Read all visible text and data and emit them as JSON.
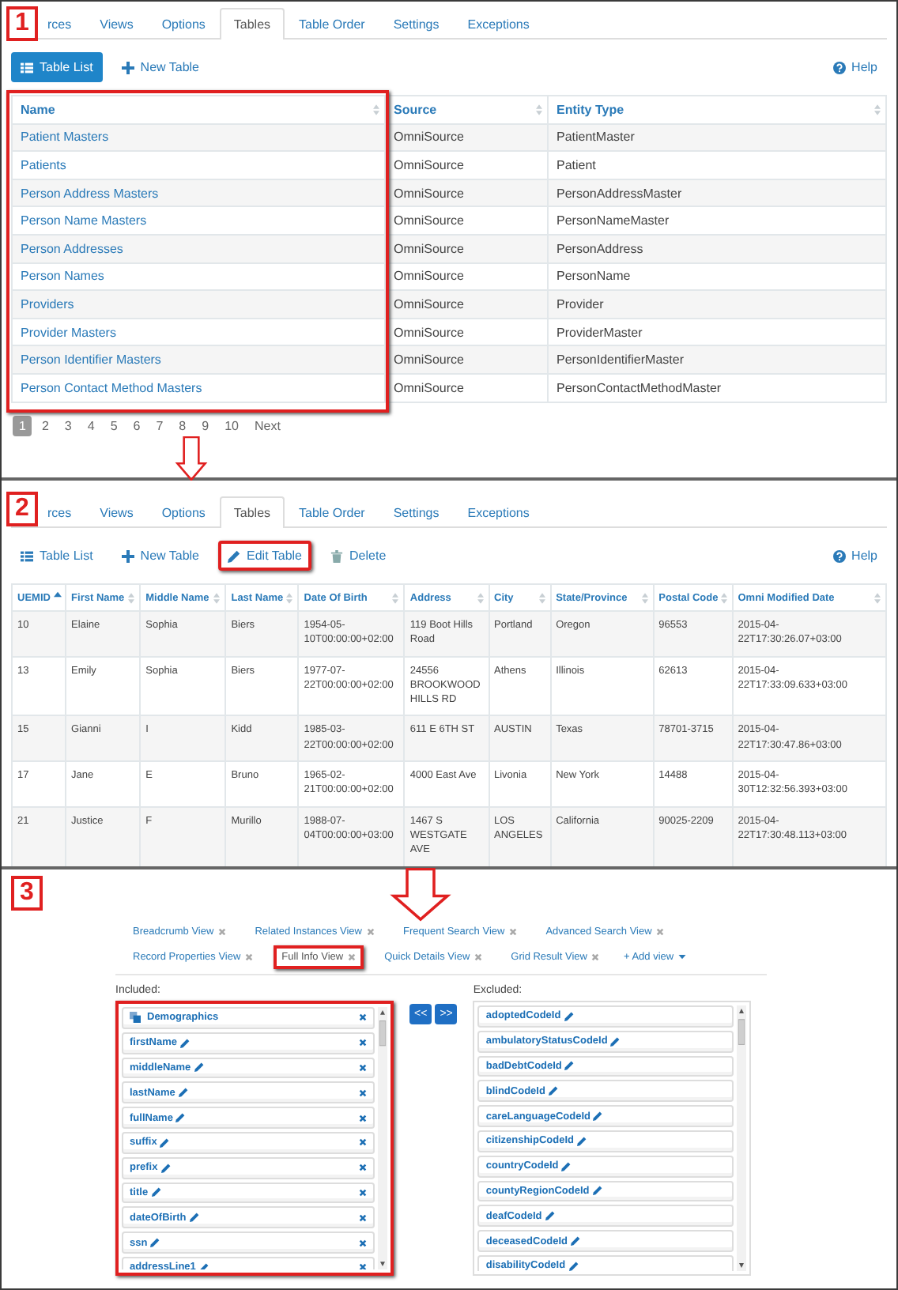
{
  "step_1": {
    "badge": "1",
    "tabs": [
      {
        "label": "rces",
        "selected": false
      },
      {
        "label": "Views",
        "selected": false
      },
      {
        "label": "Options",
        "selected": false
      },
      {
        "label": "Tables",
        "selected": true
      },
      {
        "label": "Table Order",
        "selected": false
      },
      {
        "label": "Settings",
        "selected": false
      },
      {
        "label": "Exceptions",
        "selected": false
      }
    ],
    "toolbar": [
      {
        "label": "Table List",
        "kind": "list",
        "primary": true,
        "highlighted": false
      },
      {
        "label": "New Table",
        "kind": "new",
        "primary": false,
        "highlighted": false
      }
    ],
    "help": "Help",
    "table": {
      "columns": [
        {
          "label": "Name",
          "sorted": false,
          "highlighted": true
        },
        {
          "label": "Source",
          "sorted": false,
          "highlighted": false
        },
        {
          "label": "Entity Type",
          "sorted": false,
          "highlighted": false
        }
      ],
      "rows": [
        [
          "Patient Masters",
          "OmniSource",
          "PatientMaster"
        ],
        [
          "Patients",
          "OmniSource",
          "Patient"
        ],
        [
          "Person Address Masters",
          "OmniSource",
          "PersonAddressMaster"
        ],
        [
          "Person Name Masters",
          "OmniSource",
          "PersonNameMaster"
        ],
        [
          "Person Addresses",
          "OmniSource",
          "PersonAddress"
        ],
        [
          "Person Names",
          "OmniSource",
          "PersonName"
        ],
        [
          "Providers",
          "OmniSource",
          "Provider"
        ],
        [
          "Provider Masters",
          "OmniSource",
          "ProviderMaster"
        ],
        [
          "Person Identifier Masters",
          "OmniSource",
          "PersonIdentifierMaster"
        ],
        [
          "Person Contact Method Masters",
          "OmniSource",
          "PersonContactMethodMaster"
        ]
      ]
    },
    "pagination": [
      {
        "label": "1",
        "selected": true
      },
      {
        "label": "2",
        "selected": false
      },
      {
        "label": "3",
        "selected": false
      },
      {
        "label": "4",
        "selected": false
      },
      {
        "label": "5",
        "selected": false
      },
      {
        "label": "6",
        "selected": false
      },
      {
        "label": "7",
        "selected": false
      },
      {
        "label": "8",
        "selected": false
      },
      {
        "label": "9",
        "selected": false
      },
      {
        "label": "10",
        "selected": false
      },
      {
        "label": "Next",
        "selected": false
      }
    ]
  },
  "step_2": {
    "badge": "2",
    "tabs": [
      {
        "label": "rces",
        "selected": false
      },
      {
        "label": "Views",
        "selected": false
      },
      {
        "label": "Options",
        "selected": false
      },
      {
        "label": "Tables",
        "selected": true
      },
      {
        "label": "Table Order",
        "selected": false
      },
      {
        "label": "Settings",
        "selected": false
      },
      {
        "label": "Exceptions",
        "selected": false
      }
    ],
    "toolbar": [
      {
        "label": "Table List",
        "kind": "list",
        "primary": false,
        "highlighted": false
      },
      {
        "label": "New Table",
        "kind": "new",
        "primary": false,
        "highlighted": false
      },
      {
        "label": "Edit Table",
        "kind": "edit",
        "primary": false,
        "highlighted": true
      },
      {
        "label": "Delete",
        "kind": "delete",
        "primary": false,
        "highlighted": false
      }
    ],
    "help": "Help",
    "table": {
      "columns": [
        {
          "label": "UEMID",
          "sorted": true
        },
        {
          "label": "First Name",
          "sorted": false
        },
        {
          "label": "Middle Name",
          "sorted": false
        },
        {
          "label": "Last Name",
          "sorted": false
        },
        {
          "label": "Date Of Birth",
          "sorted": false
        },
        {
          "label": "Address",
          "sorted": false
        },
        {
          "label": "City",
          "sorted": false
        },
        {
          "label": "State/Province",
          "sorted": false
        },
        {
          "label": "Postal Code",
          "sorted": false
        },
        {
          "label": "Omni Modified Date",
          "sorted": false
        }
      ],
      "rows": [
        [
          "10",
          "Elaine",
          "Sophia",
          "Biers",
          "1954-05-10T00:00:00+02:00",
          "119 Boot Hills Road",
          "Portland",
          "Oregon",
          "96553",
          "2015-04-22T17:30:26.07+03:00"
        ],
        [
          "13",
          "Emily",
          "Sophia",
          "Biers",
          "1977-07-22T00:00:00+02:00",
          "24556 BROOKWOOD HILLS RD",
          "Athens",
          "Illinois",
          "62613",
          "2015-04-22T17:33:09.633+03:00"
        ],
        [
          "15",
          "Gianni",
          "I",
          "Kidd",
          "1985-03-22T00:00:00+02:00",
          "611 E 6TH ST",
          "AUSTIN",
          "Texas",
          "78701-3715",
          "2015-04-22T17:30:47.86+03:00"
        ],
        [
          "17",
          "Jane",
          "E",
          "Bruno",
          "1965-02-21T00:00:00+02:00",
          "4000 East Ave",
          "Livonia",
          "New York",
          "14488",
          "2015-04-30T12:32:56.393+03:00"
        ],
        [
          "21",
          "Justice",
          "F",
          "Murillo",
          "1988-07-04T00:00:00+03:00",
          "1467 S WESTGATE AVE",
          "LOS ANGELES",
          "California",
          "90025-2209",
          "2015-04-22T17:30:48.113+03:00"
        ]
      ]
    }
  },
  "step_3": {
    "badge": "3",
    "views": [
      {
        "label": "Breadcrumb View",
        "selected": false,
        "highlighted": false
      },
      {
        "label": "Related Instances View",
        "selected": false,
        "highlighted": false
      },
      {
        "label": "Frequent Search View",
        "selected": false,
        "highlighted": false
      },
      {
        "label": "Advanced Search View",
        "selected": false,
        "highlighted": false
      },
      {
        "label": "Record Properties View",
        "selected": false,
        "highlighted": false
      },
      {
        "label": "Full Info View",
        "selected": true,
        "highlighted": true
      },
      {
        "label": "Quick Details View",
        "selected": false,
        "highlighted": false
      },
      {
        "label": "Grid Result View",
        "selected": false,
        "highlighted": false
      }
    ],
    "add_view": "+ Add view",
    "included_label": "Included:",
    "excluded_label": "Excluded:",
    "included_highlighted": true,
    "included": [
      {
        "label": "Demographics",
        "kind": "group"
      },
      {
        "label": "firstName",
        "kind": "field"
      },
      {
        "label": "middleName",
        "kind": "field"
      },
      {
        "label": "lastName",
        "kind": "field"
      },
      {
        "label": "fullName",
        "kind": "field"
      },
      {
        "label": "suffix",
        "kind": "field"
      },
      {
        "label": "prefix",
        "kind": "field"
      },
      {
        "label": "title",
        "kind": "field"
      },
      {
        "label": "dateOfBirth",
        "kind": "field"
      },
      {
        "label": "ssn",
        "kind": "field"
      },
      {
        "label": "addressLine1",
        "kind": "field"
      }
    ],
    "move_buttons": [
      "<<",
      ">>"
    ],
    "excluded": [
      {
        "label": "adoptedCodeId",
        "kind": "field"
      },
      {
        "label": "ambulatoryStatusCodeId",
        "kind": "field"
      },
      {
        "label": "badDebtCodeId",
        "kind": "field"
      },
      {
        "label": "blindCodeId",
        "kind": "field"
      },
      {
        "label": "careLanguageCodeId",
        "kind": "field"
      },
      {
        "label": "citizenshipCodeId",
        "kind": "field"
      },
      {
        "label": "countryCodeId",
        "kind": "field"
      },
      {
        "label": "countyRegionCodeId",
        "kind": "field"
      },
      {
        "label": "deafCodeId",
        "kind": "field"
      },
      {
        "label": "deceasedCodeId",
        "kind": "field"
      },
      {
        "label": "disabilityCodeId",
        "kind": "field"
      }
    ]
  }
}
